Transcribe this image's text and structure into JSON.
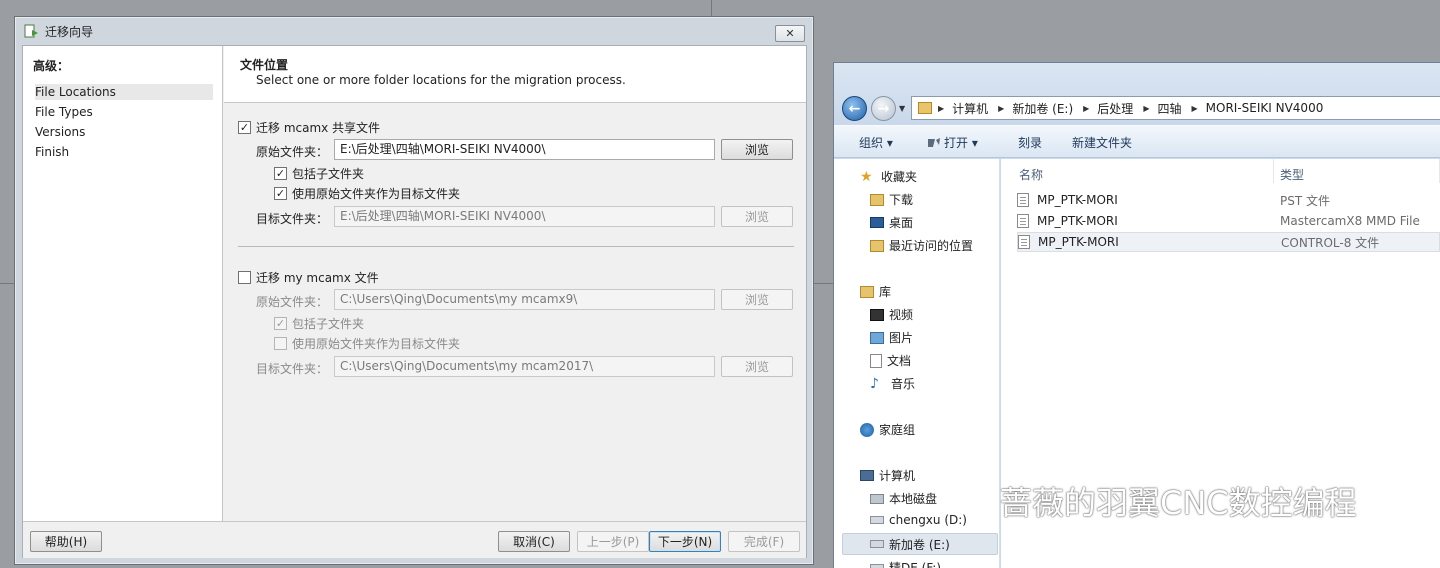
{
  "wizard": {
    "title": "迁移向导",
    "close_label": "✕",
    "side": {
      "title": "高级：",
      "items": [
        {
          "label": "File Locations",
          "active": true
        },
        {
          "label": "File Types",
          "active": false
        },
        {
          "label": "Versions",
          "active": false
        },
        {
          "label": "Finish",
          "active": false
        }
      ]
    },
    "header": {
      "title": "文件位置",
      "subtitle": "Select one or more folder locations for the migration process."
    },
    "shared": {
      "checkbox_label": "迁移 mcamx 共享文件",
      "checked": true,
      "source_label": "原始文件夹：",
      "source_value": "E:\\后处理\\四轴\\MORI-SEIKI NV4000\\",
      "include_sub_label": "包括子文件夹",
      "use_source_label": "使用原始文件夹作为目标文件夹",
      "target_label": "目标文件夹：",
      "target_value": "E:\\后处理\\四轴\\MORI-SEIKI NV4000\\",
      "browse": "浏览"
    },
    "my": {
      "checkbox_label": "迁移 my mcamx 文件",
      "checked": false,
      "source_label": "原始文件夹：",
      "source_value": "C:\\Users\\Qing\\Documents\\my mcamx9\\",
      "include_sub_label": "包括子文件夹",
      "use_source_label": "使用原始文件夹作为目标文件夹",
      "target_label": "目标文件夹：",
      "target_value": "C:\\Users\\Qing\\Documents\\my mcam2017\\",
      "browse": "浏览"
    },
    "footer": {
      "help": "帮助(H)",
      "cancel": "取消(C)",
      "back": "上一步(P)",
      "next": "下一步(N)",
      "finish": "完成(F)"
    }
  },
  "explorer": {
    "breadcrumb": [
      "计算机",
      "新加卷 (E:)",
      "后处理",
      "四轴",
      "MORI-SEIKI NV4000"
    ],
    "toolbar": {
      "organize": "组织 ▾",
      "open": "打开 ▾",
      "burn": "刻录",
      "new_folder": "新建文件夹"
    },
    "nav": {
      "favorites": "收藏夹",
      "downloads": "下载",
      "desktop": "桌面",
      "recent": "最近访问的位置",
      "libraries": "库",
      "videos": "视频",
      "pictures": "图片",
      "documents": "文档",
      "music": "音乐",
      "homegroup": "家庭组",
      "computer": "计算机",
      "local_disk": "本地磁盘",
      "drive_d": "chengxu (D:)",
      "drive_e": "新加卷 (E:)",
      "drive_f": "精DE (F:)"
    },
    "columns": {
      "name": "名称",
      "type": "类型"
    },
    "files": [
      {
        "name": "MP_PTK-MORI",
        "type": "PST 文件"
      },
      {
        "name": "MP_PTK-MORI",
        "type": "MastercamX8 MMD File"
      },
      {
        "name": "MP_PTK-MORI",
        "type": "CONTROL-8 文件"
      }
    ]
  },
  "watermark": "蔷薇的羽翼CNC数控编程"
}
